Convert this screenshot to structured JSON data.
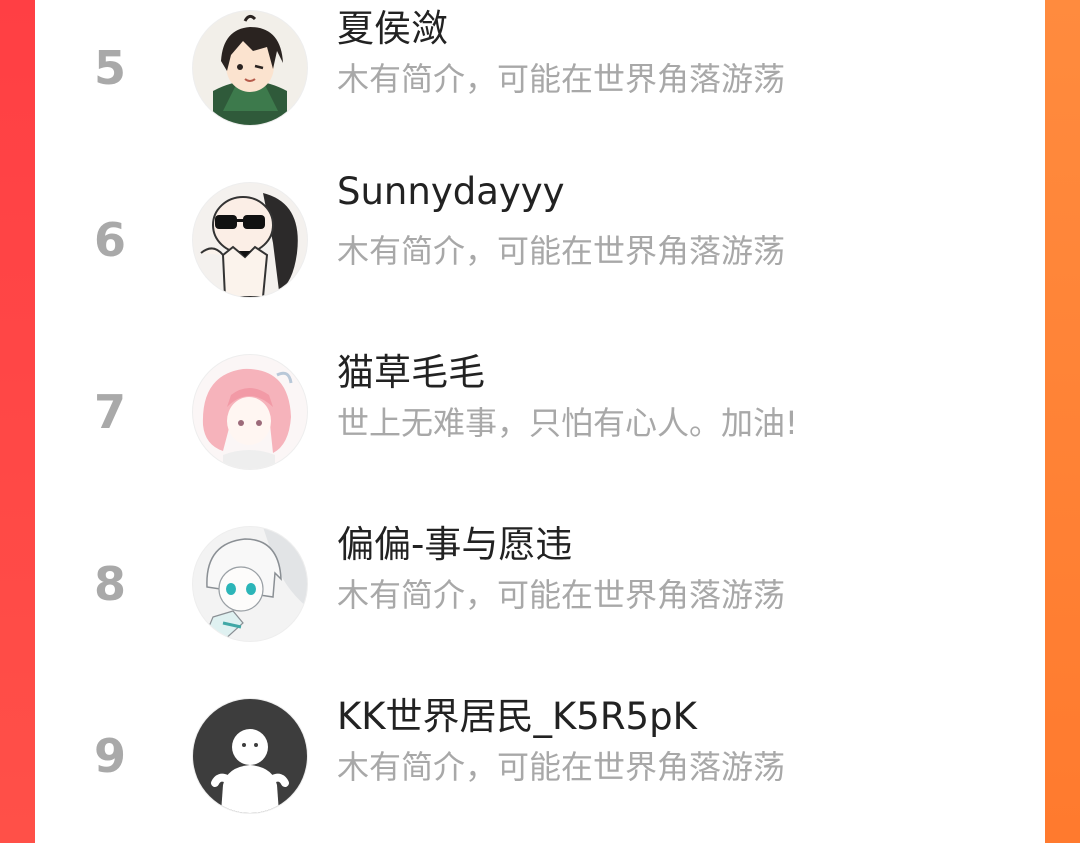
{
  "list": {
    "items": [
      {
        "rank": "5",
        "name": "夏侯潋",
        "bio": "木有简介，可能在世界角落游荡",
        "avatar_icon": "avatar-anime-boy-icon"
      },
      {
        "rank": "6",
        "name": "Sunnydayyy",
        "bio": "木有简介，可能在世界角落游荡",
        "avatar_icon": "avatar-sunglasses-icon"
      },
      {
        "rank": "7",
        "name": "猫草毛毛",
        "bio": "世上无难事，只怕有心人。加油!",
        "avatar_icon": "avatar-pink-hair-icon"
      },
      {
        "rank": "8",
        "name": "偏偏-事与愿违",
        "bio": "木有简介，可能在世界角落游荡",
        "avatar_icon": "avatar-anime-girl-icon"
      },
      {
        "rank": "9",
        "name": "KK世界居民_K5R5pK",
        "bio": "木有简介，可能在世界角落游荡",
        "avatar_icon": "avatar-default-icon"
      }
    ]
  },
  "colors": {
    "left_edge": "#ff4a4a",
    "right_edge": "#ff7b31",
    "rank_text": "#a9a9a9",
    "name_text": "#222222",
    "bio_text": "#a8a8a8"
  }
}
